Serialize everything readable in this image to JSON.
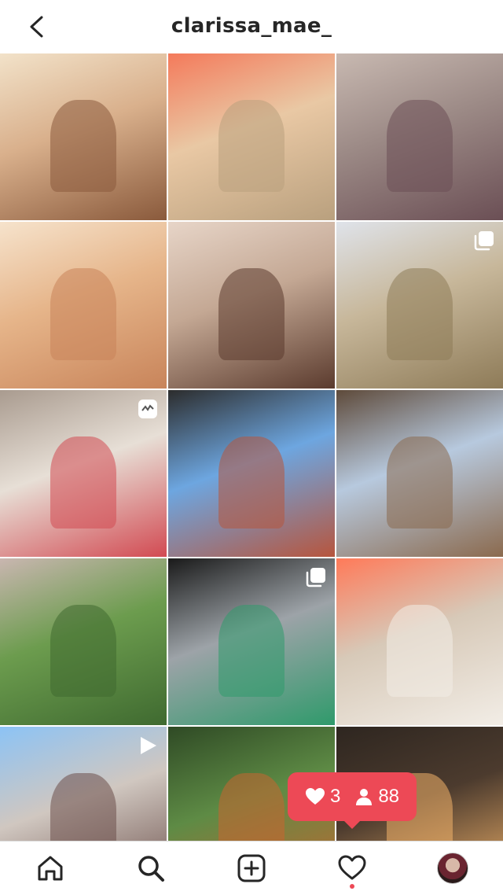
{
  "header": {
    "username": "clarissa_mae_"
  },
  "grid": {
    "tiles": [
      {
        "name": "post-sound-bath-duo",
        "colors": [
          "#d9b08c",
          "#8a5a3c",
          "#f2e2c9"
        ],
        "badge": ""
      },
      {
        "name": "post-singing-bowls",
        "colors": [
          "#e9c8a4",
          "#b9a07e",
          "#f47a5b"
        ],
        "badge": ""
      },
      {
        "name": "post-yoga-pose-kneeling",
        "colors": [
          "#9c8a86",
          "#6b4f55",
          "#c8b9b1"
        ],
        "badge": ""
      },
      {
        "name": "post-bowls-room",
        "colors": [
          "#e6b58a",
          "#c8845a",
          "#f6e3cc"
        ],
        "badge": ""
      },
      {
        "name": "post-portrait",
        "colors": [
          "#c4a894",
          "#5b3b2e",
          "#e7d5c8"
        ],
        "badge": ""
      },
      {
        "name": "post-dog-field",
        "colors": [
          "#c7b79a",
          "#8e7b58",
          "#dfe3ea"
        ],
        "badge": "multi"
      },
      {
        "name": "post-yoga-back",
        "colors": [
          "#e7dfd6",
          "#d24a52",
          "#a99b8f"
        ],
        "badge": "reel"
      },
      {
        "name": "post-deck-meditation",
        "colors": [
          "#6da6e0",
          "#b7553d",
          "#2c2c2c"
        ],
        "badge": ""
      },
      {
        "name": "post-bridge-yoga",
        "colors": [
          "#b7c9de",
          "#8b6a4e",
          "#5e4a3a"
        ],
        "badge": ""
      },
      {
        "name": "post-outdoor-class",
        "colors": [
          "#6c9c4e",
          "#3f6a30",
          "#c9b6b0"
        ],
        "badge": ""
      },
      {
        "name": "post-selfie-dogs",
        "colors": [
          "#9da3a8",
          "#2f9a6b",
          "#1a1a1a"
        ],
        "badge": "multi"
      },
      {
        "name": "post-bowl-seated",
        "colors": [
          "#d7c9b8",
          "#f2ede6",
          "#ff7a59"
        ],
        "badge": ""
      },
      {
        "name": "post-bowls-evening",
        "colors": [
          "#d0c7c0",
          "#6b4f4a",
          "#8cc3f5"
        ],
        "badge": "video"
      },
      {
        "name": "post-forest-duo",
        "colors": [
          "#5e8b45",
          "#c8652f",
          "#2f4a25"
        ],
        "badge": ""
      },
      {
        "name": "post-salt-lamp",
        "colors": [
          "#4c3b2e",
          "#f2b36a",
          "#2e2620"
        ],
        "badge": ""
      }
    ]
  },
  "notification": {
    "likes": "3",
    "followers": "88"
  },
  "bottomNav": {
    "items": [
      "home",
      "search",
      "create",
      "activity",
      "profile"
    ]
  },
  "icons": {
    "back": "back-icon",
    "home": "home-icon",
    "search": "search-icon",
    "create": "plus-square-icon",
    "activity": "heart-icon",
    "profile": "avatar"
  },
  "colors": {
    "accent": "#ed4956",
    "text": "#262626"
  }
}
